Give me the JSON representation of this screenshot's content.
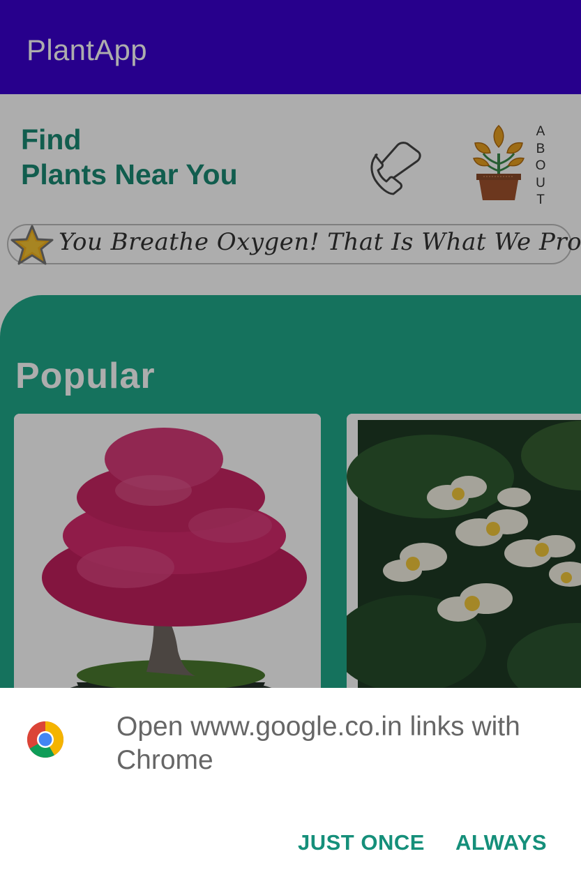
{
  "app_bar": {
    "title": "PlantApp"
  },
  "header": {
    "headline_line1": "Find",
    "headline_line2": "Plants Near You",
    "about_letters": [
      "A",
      "B",
      "O",
      "U",
      "T"
    ],
    "tagline": "You Breathe Oxygen! That Is What We Provide",
    "icons": [
      "phone-icon",
      "plant-pot-logo",
      "star-icon"
    ]
  },
  "popular": {
    "title": "Popular",
    "cards": [
      {
        "image": "pink-bonsai-tree"
      },
      {
        "image": "white-yellow-plumeria-flowers"
      }
    ]
  },
  "dialog": {
    "icon": "chrome-icon",
    "message": "Open www.google.co.in links with Chrome",
    "just_once_label": "JUST ONCE",
    "always_label": "ALWAYS"
  },
  "colors": {
    "app_bar": "#3a00cf",
    "accent_green": "#1a8a73",
    "popular_panel": "#20a88a",
    "dialog_button": "#158f7a",
    "scrim": "rgba(0,0,0,0.32)"
  }
}
